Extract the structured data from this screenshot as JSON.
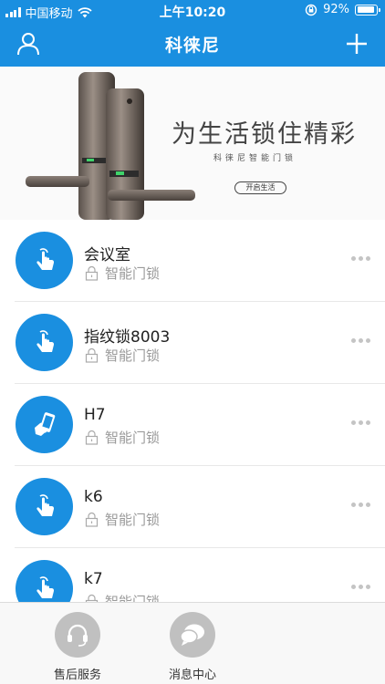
{
  "status_bar": {
    "carrier": "中国移动",
    "time": "上午10:20",
    "battery_percent": "92%",
    "battery_level": 0.92,
    "icons": [
      "signal-icon",
      "wifi-icon",
      "rotation-lock-icon",
      "battery-icon"
    ]
  },
  "nav": {
    "title": "科徕尼",
    "left_icon": "user-icon",
    "right_icon": "plus-icon"
  },
  "banner": {
    "slogan": "为生活锁住精彩",
    "subtitle": "科徕尼智能门锁",
    "button_label": "开启生活"
  },
  "devices": [
    {
      "name": "会议室",
      "type": "智能门锁",
      "icon": "finger-touch-icon"
    },
    {
      "name": "指纹锁8003",
      "type": "智能门锁",
      "icon": "finger-touch-icon"
    },
    {
      "name": "H7",
      "type": "智能门锁",
      "icon": "phone-in-hand-icon"
    },
    {
      "name": "k6",
      "type": "智能门锁",
      "icon": "finger-touch-icon"
    },
    {
      "name": "k7",
      "type": "智能门锁",
      "icon": "finger-touch-icon"
    }
  ],
  "tabbar": {
    "service_label": "售后服务",
    "message_label": "消息中心",
    "service_icon": "headset-icon",
    "message_icon": "chat-bubbles-icon"
  },
  "colors": {
    "primary": "#1a8fe0",
    "secondary_text": "#9a9a9a",
    "tab_icon_bg": "#c0c0c0"
  }
}
